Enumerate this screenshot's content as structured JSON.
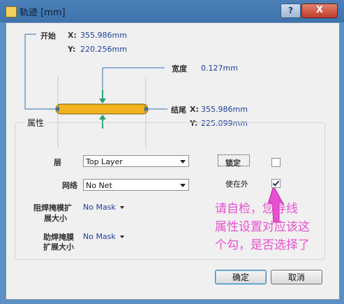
{
  "window": {
    "title": "轨迹 [mm]",
    "help_glyph": "?",
    "close_glyph": "X"
  },
  "geometry": {
    "start_label": "开始",
    "start_x_label": "X:",
    "start_x": "355.986mm",
    "start_y_label": "Y:",
    "start_y": "220.256mm",
    "width_label": "宽度",
    "width_value": "0.127mm",
    "end_label": "结尾",
    "end_x_label": "X:",
    "end_x": "355.986mm",
    "end_y_label": "Y:",
    "end_y": "225.099mm"
  },
  "properties": {
    "group_label": "属性",
    "layer_label": "层",
    "layer_value": "Top Layer",
    "net_label": "网络",
    "net_value": "No Net",
    "locked_label": "锁定",
    "locked": false,
    "keepout_label": "使在外",
    "keepout": true,
    "solder_mask_label_1": "阻焊掩模扩",
    "solder_mask_label_2": "展大小",
    "solder_mask_value": "No Mask",
    "paste_mask_label_1": "助焊掩膜",
    "paste_mask_label_2": "扩展大小",
    "paste_mask_value": "No Mask"
  },
  "annotation": {
    "line1": "请自检，您导线",
    "line2": "属性设置对应该这",
    "line3": "个勾，是否选择了"
  },
  "buttons": {
    "ok": "确定",
    "cancel": "取消"
  },
  "colors": {
    "track": "#f3b31c",
    "arrow": "#2aa06a",
    "annotation": "#e84fd0",
    "value_text": "#1f3f9a"
  }
}
